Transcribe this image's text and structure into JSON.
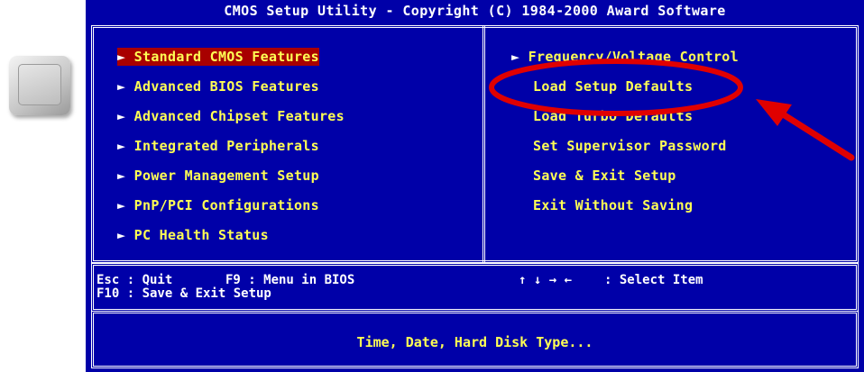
{
  "title": "CMOS Setup Utility - Copyright (C) 1984-2000 Award Software",
  "left_menu": [
    {
      "label": "Standard CMOS Features",
      "selected": true
    },
    {
      "label": "Advanced BIOS Features",
      "selected": false
    },
    {
      "label": "Advanced Chipset Features",
      "selected": false
    },
    {
      "label": "Integrated Peripherals",
      "selected": false
    },
    {
      "label": "Power Management Setup",
      "selected": false
    },
    {
      "label": "PnP/PCI Configurations",
      "selected": false
    },
    {
      "label": "PC Health Status",
      "selected": false
    }
  ],
  "right_menu": [
    {
      "label": "Frequency/Voltage Control",
      "submenu": true
    },
    {
      "label": "Load Setup Defaults",
      "submenu": false
    },
    {
      "label": "Load Turbo Defaults",
      "submenu": false
    },
    {
      "label": "Set Supervisor Password",
      "submenu": false
    },
    {
      "label": "Save & Exit Setup",
      "submenu": false
    },
    {
      "label": "Exit Without Saving",
      "submenu": false
    }
  ],
  "help": {
    "line1_left": "Esc : Quit",
    "line1_mid": "F9 : Menu in BIOS",
    "line2_left": "F10 : Save & Exit Setup",
    "nav_keys": "↑ ↓ → ←",
    "nav_label": ": Select Item"
  },
  "status": "Time, Date, Hard Disk Type...",
  "colors": {
    "screen_bg": "#0000a8",
    "item_text": "#ffff54",
    "selection_bg": "#a80000",
    "annotation": "#e00000"
  },
  "icons": {
    "submenu_marker": "triangle-right-icon",
    "side_key": "keyboard-key-icon"
  }
}
